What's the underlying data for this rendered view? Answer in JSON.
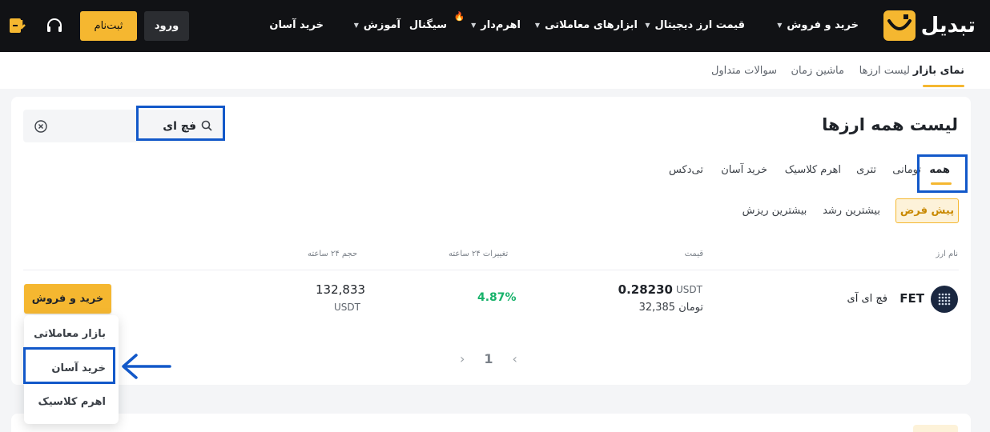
{
  "header": {
    "brand": "تبدیل",
    "nav": [
      {
        "label": "خرید و فروش",
        "has_caret": true
      },
      {
        "label": "قیمت ارز دیجیتال",
        "has_caret": true
      },
      {
        "label": "ابزارهای معاملاتی",
        "has_caret": true
      },
      {
        "label": "اهرم‌دار",
        "has_caret": true
      },
      {
        "label": "سیگنال",
        "has_caret": false
      },
      {
        "label": "آموزش",
        "has_caret": true
      },
      {
        "label": "خرید آسان",
        "has_caret": false
      }
    ],
    "login_label": "ورود",
    "signup_label": "ثبت‌نام",
    "icons": [
      "headset-icon",
      "download-icon",
      "fire-icon"
    ]
  },
  "subnav": {
    "items": [
      "نمای بازار",
      "لیست ارزها",
      "ماشین زمان",
      "سوالات متداول"
    ],
    "active_index": 0
  },
  "main": {
    "title": "لیست همه ارزها",
    "search": {
      "value": "فچ ای",
      "placeholder": ""
    },
    "tabs": [
      "همه",
      "تومانی",
      "تتری",
      "اهرم کلاسیک",
      "خرید آسان",
      "تی‌دکس"
    ],
    "active_tab": 0,
    "sort_chips": [
      "پیش فرض",
      "بیشترین رشد",
      "بیشترین ریزش"
    ],
    "active_chip": 0,
    "columns": {
      "name": "نام ارز",
      "price": "قیمت",
      "change": "تغییرات ۲۴ ساعته",
      "volume": "حجم ۲۴ ساعته"
    },
    "rows": [
      {
        "symbol": "FET",
        "name": "فچ ای آی",
        "price": "0.28230",
        "price_unit": "USDT",
        "price_toman": "تومان 32,385",
        "change": "4.87%",
        "volume": "132,833",
        "volume_unit": "USDT",
        "action_label": "خرید و فروش"
      }
    ],
    "pagination": {
      "current": "1"
    },
    "action_menu": [
      "بازار معاملاتی",
      "خرید آسان",
      "اهرم کلاسیک"
    ]
  },
  "colors": {
    "accent": "#f5b730",
    "header_bg": "#111215",
    "positive": "#17b26a",
    "annotation": "#1258c9"
  }
}
